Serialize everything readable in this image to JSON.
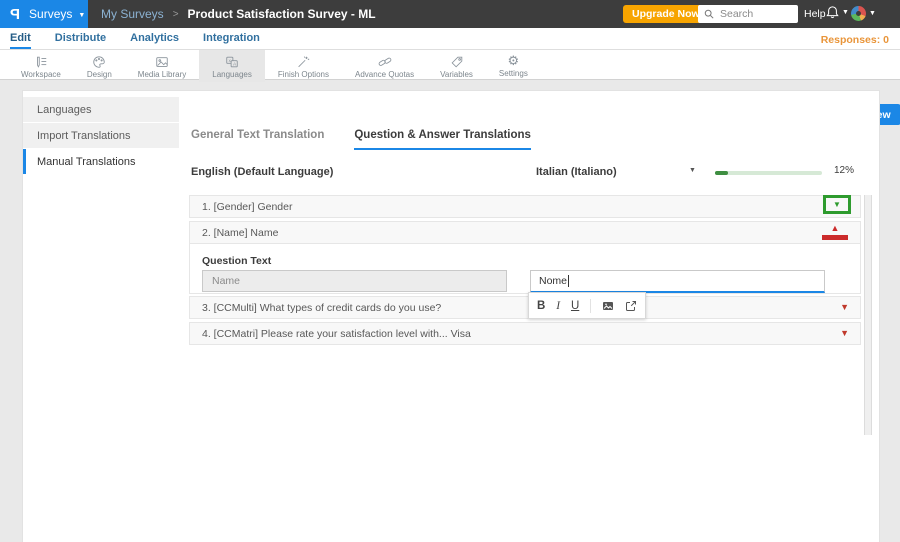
{
  "header": {
    "logo_text": "P",
    "app_menu_label": "Surveys",
    "breadcrumb_root": "My Surveys",
    "breadcrumb_separator": ">",
    "page_title": "Product Satisfaction Survey - ML",
    "upgrade_button": "Upgrade Now",
    "search_placeholder": "Search",
    "help_label": "Help"
  },
  "nav": {
    "items": [
      "Edit",
      "Distribute",
      "Analytics",
      "Integration"
    ],
    "active_item": "Edit",
    "responses_label": "Responses: 0"
  },
  "ribbon": {
    "items": [
      "Workspace",
      "Design",
      "Media Library",
      "Languages",
      "Finish Options",
      "Advance Quotas",
      "Variables",
      "Settings"
    ],
    "active_item": "Languages",
    "survey_url": "https://questionpro.com/t/AW22Zd1S1",
    "preview_button": "Preview"
  },
  "sidebar": {
    "items": [
      "Languages",
      "Import Translations",
      "Manual Translations"
    ],
    "active_item": "Manual Translations"
  },
  "content": {
    "tabs": [
      "General Text Translation",
      "Question & Answer Translations"
    ],
    "active_tab": "Question & Answer Translations",
    "source_language": "English (Default Language)",
    "target_language": "Italian (Italiano)",
    "progress_percent_label": "12%",
    "progress_value": 12,
    "questions": [
      {
        "label": "1. [Gender] Gender",
        "state": "collapsed-highlighted-green"
      },
      {
        "label": "2. [Name] Name",
        "state": "expanded-highlighted-red"
      },
      {
        "label": "3. [CCMulti] What types of credit cards do you use?",
        "state": "collapsed"
      },
      {
        "label": "4. [CCMatri] Please rate your satisfaction level with... Visa",
        "state": "collapsed"
      }
    ],
    "editor": {
      "section_label": "Question Text",
      "source_value": "Name",
      "target_value": "Nome",
      "format_glyphs": {
        "bold": "B",
        "italic": "I",
        "underline": "U"
      },
      "format_buttons": [
        "Bold",
        "Italic",
        "Underline",
        "Insert Image",
        "Insert Link"
      ]
    }
  },
  "colors": {
    "accent_blue": "#1b87e6",
    "header_dark": "#3d3d3d",
    "upgrade_orange": "#f7a400",
    "responses_orange": "#e9953a",
    "annotation_green": "#2e9b2e",
    "annotation_red": "#cc2b2b",
    "progress_green": "#3e8e41"
  }
}
